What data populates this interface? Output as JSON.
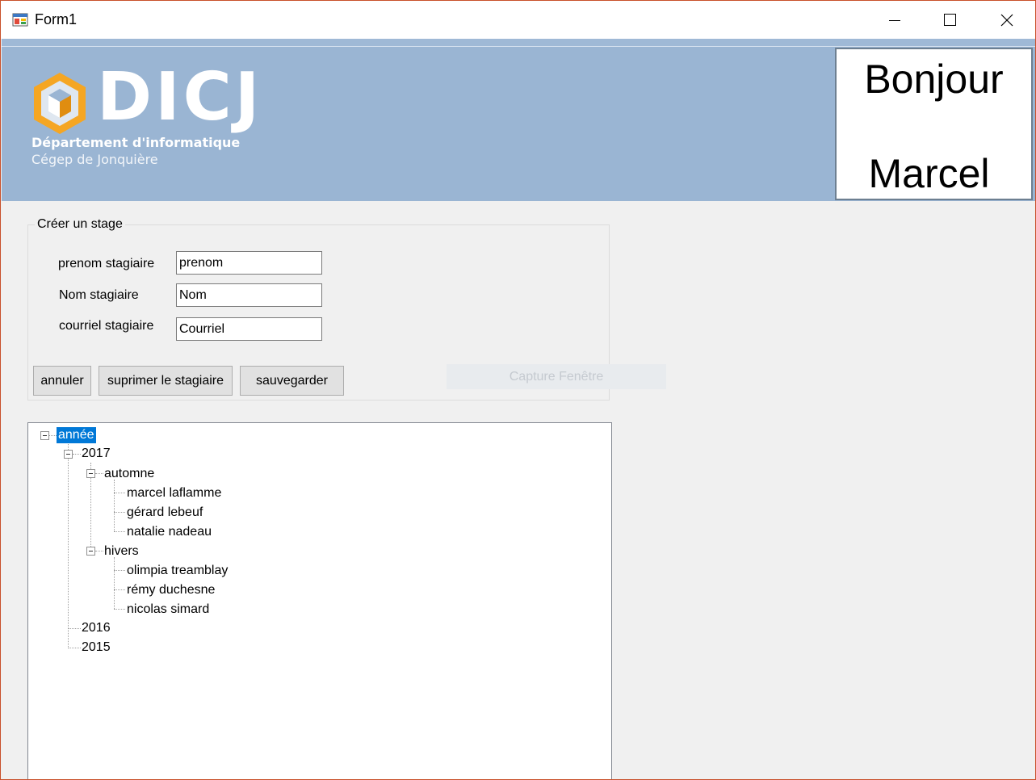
{
  "window": {
    "title": "Form1",
    "minimize_icon": "minimize-icon",
    "maximize_icon": "maximize-icon",
    "close_icon": "close-icon"
  },
  "banner": {
    "logo_text": "DICJ",
    "department": "Département d'informatique",
    "college": "Cégep de Jonquière",
    "background_color": "#9ab5d3",
    "logo_accent_color": "#f5a623"
  },
  "greeting": {
    "line1": "Bonjour",
    "line2": "Marcel"
  },
  "form": {
    "group_title": "Créer un stage",
    "fields": [
      {
        "label": "prenom stagiaire",
        "value": "prenom"
      },
      {
        "label": "Nom stagiaire",
        "value": "Nom"
      },
      {
        "label": "courriel stagiaire",
        "value": "Courriel"
      }
    ],
    "buttons": {
      "cancel": "annuler",
      "delete": "suprimer le stagiaire",
      "save": "sauvegarder"
    },
    "capture_overlay": "Capture Fenêtre"
  },
  "tree": {
    "root": "année",
    "year_2017": "2017",
    "season_autumn": "automne",
    "autumn_students": [
      "marcel laflamme",
      "gérard lebeuf",
      "natalie nadeau"
    ],
    "season_winter": "hivers",
    "winter_students": [
      "olimpia treamblay",
      "rémy duchesne",
      "nicolas simard"
    ],
    "year_2016": "2016",
    "year_2015": "2015",
    "selection_color": "#0078d7"
  }
}
